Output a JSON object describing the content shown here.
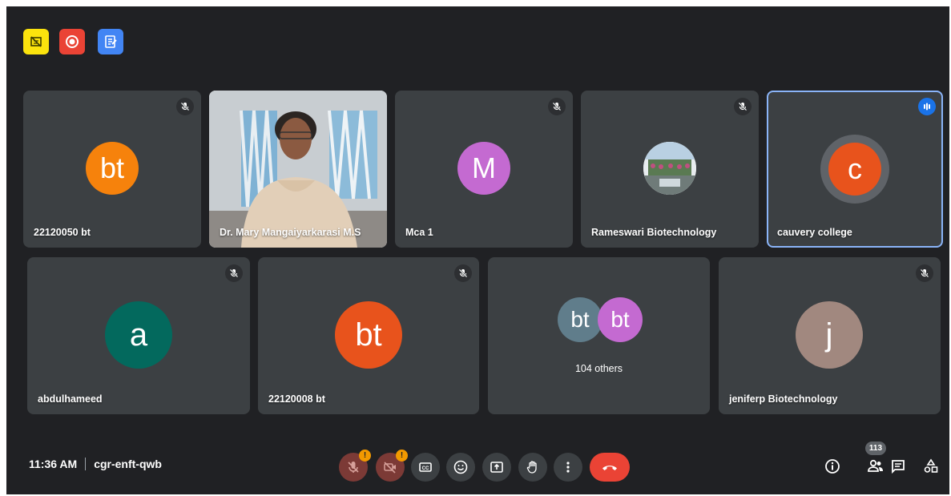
{
  "top_icons": [
    {
      "name": "no-video-icon",
      "color": "#fbe30d"
    },
    {
      "name": "record-icon",
      "color": "#ea4335"
    },
    {
      "name": "notes-icon",
      "color": "#4285f4"
    }
  ],
  "participants": [
    {
      "name": "22120050 bt",
      "initials": "bt",
      "avatar_color": "#f6820c",
      "muted": true
    },
    {
      "name": "Dr. Mary Mangaiyarkarasi M.S",
      "video": true
    },
    {
      "name": "Mca 1",
      "initials": "M",
      "avatar_color": "#c46ad1",
      "muted": true
    },
    {
      "name": "Rameswari Biotechnology",
      "photo_avatar": true,
      "muted": true
    },
    {
      "name": "cauvery college",
      "initials": "c",
      "avatar_color": "#e8531c",
      "speaking": true
    },
    {
      "name": "abdulhameed",
      "initials": "a",
      "avatar_color": "#03695d",
      "muted": true
    },
    {
      "name": "22120008 bt",
      "initials": "bt",
      "avatar_color": "#e8531c",
      "muted": true
    },
    {
      "name": "jeniferp Biotechnology",
      "initials": "j",
      "avatar_color": "#a1887f",
      "muted": true
    }
  ],
  "others": {
    "label": "104 others",
    "avatars": [
      {
        "initials": "bt",
        "color": "#607d8b"
      },
      {
        "initials": "bt",
        "color": "#c46ad1"
      }
    ]
  },
  "meeting": {
    "time": "11:36 AM",
    "code": "cgr-enft-qwb"
  },
  "controls": [
    {
      "name": "mic-off-icon",
      "alert": "!"
    },
    {
      "name": "camera-off-icon",
      "alert": "!"
    },
    {
      "name": "captions-icon"
    },
    {
      "name": "emoji-icon"
    },
    {
      "name": "present-icon"
    },
    {
      "name": "raise-hand-icon"
    },
    {
      "name": "more-options-icon"
    },
    {
      "name": "end-call-icon"
    }
  ],
  "right_panel": {
    "people_count": "113"
  }
}
